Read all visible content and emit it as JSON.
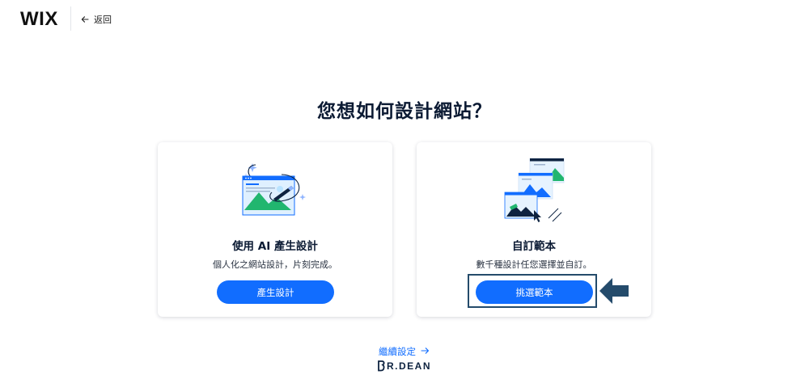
{
  "header": {
    "logo": "WIX",
    "back_label": "返回"
  },
  "main": {
    "title": "您想如何設計網站？",
    "cards": [
      {
        "title": "使用 AI 產生設計",
        "description": "個人化之網站設計，片刻完成。",
        "button_label": "產生設計"
      },
      {
        "title": "自訂範本",
        "description": "數千種設計任您選擇並自訂。",
        "button_label": "挑選範本"
      }
    ],
    "skip_label": "繼續設定"
  },
  "watermark": {
    "text": "R.DEAN"
  },
  "colors": {
    "accent": "#116dff",
    "highlight": "#244b6b",
    "text_dark": "#0b1a33"
  }
}
